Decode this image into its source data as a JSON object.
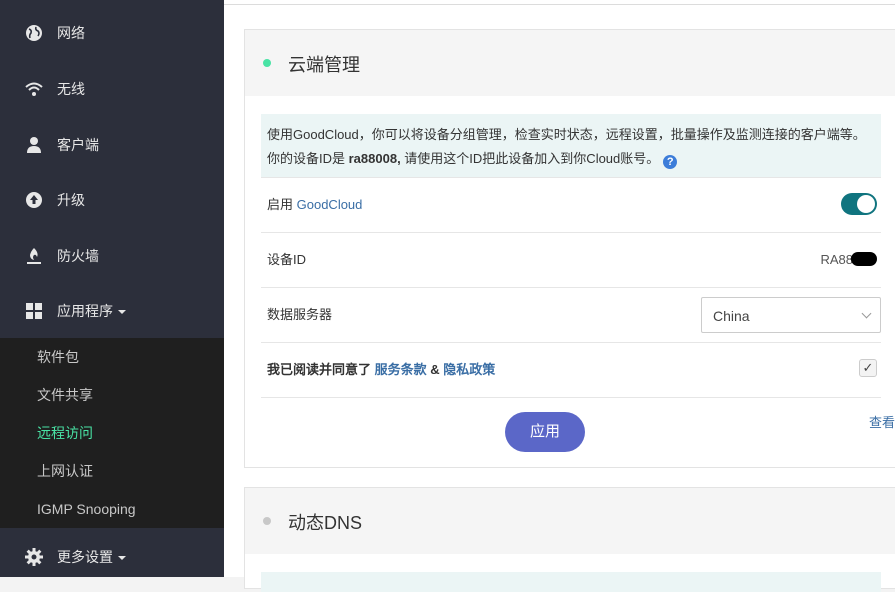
{
  "sidebar": {
    "items": [
      {
        "label": "网络",
        "icon": "globe-icon"
      },
      {
        "label": "无线",
        "icon": "wifi-icon"
      },
      {
        "label": "客户端",
        "icon": "user-icon"
      },
      {
        "label": "升级",
        "icon": "upload-icon"
      },
      {
        "label": "防火墙",
        "icon": "fire-icon"
      },
      {
        "label": "应用程序",
        "icon": "grid-icon"
      }
    ],
    "submenu": [
      {
        "label": "软件包",
        "active": false
      },
      {
        "label": "文件共享",
        "active": false
      },
      {
        "label": "远程访问",
        "active": true
      },
      {
        "label": "上网认证",
        "active": false
      },
      {
        "label": "IGMP Snooping",
        "active": false
      }
    ],
    "more": {
      "label": "更多设置",
      "icon": "gear-icon"
    },
    "colors": {
      "background": "#2c2f3b",
      "submenu_bg": "#1f1f1f",
      "active": "#49e3a5"
    }
  },
  "cloud": {
    "title": "云端管理",
    "status_color": "#49e3a5",
    "info_line1": "使用GoodCloud，你可以将设备分组管理，检查实时状态，远程设置，批量操作及监测连接的客户端等。",
    "info_line2_prefix": "你的设备ID是 ",
    "device_id_lower": "ra88008,",
    "info_line2_suffix": " 请使用这个ID把此设备加入到你Cloud账号。",
    "enable_prefix": "启用 ",
    "enable_link": "GoodCloud",
    "enabled": true,
    "device_id_label": "设备ID",
    "device_id_value": "RA88",
    "server_label": "数据服务器",
    "server_value": "China",
    "agree_prefix": "我已阅读并同意了 ",
    "terms_link": "服务条款",
    "agree_and": " & ",
    "privacy_link": "隐私政策",
    "agreed": true,
    "checkmark": "✓",
    "apply_label": "应用",
    "log_link": "查看日志",
    "colors": {
      "toggle": "#10747f",
      "button": "#5b67c8",
      "link": "#3a6ea5"
    }
  },
  "ddns": {
    "title": "动态DNS",
    "status_color": "#c8c8c8"
  }
}
